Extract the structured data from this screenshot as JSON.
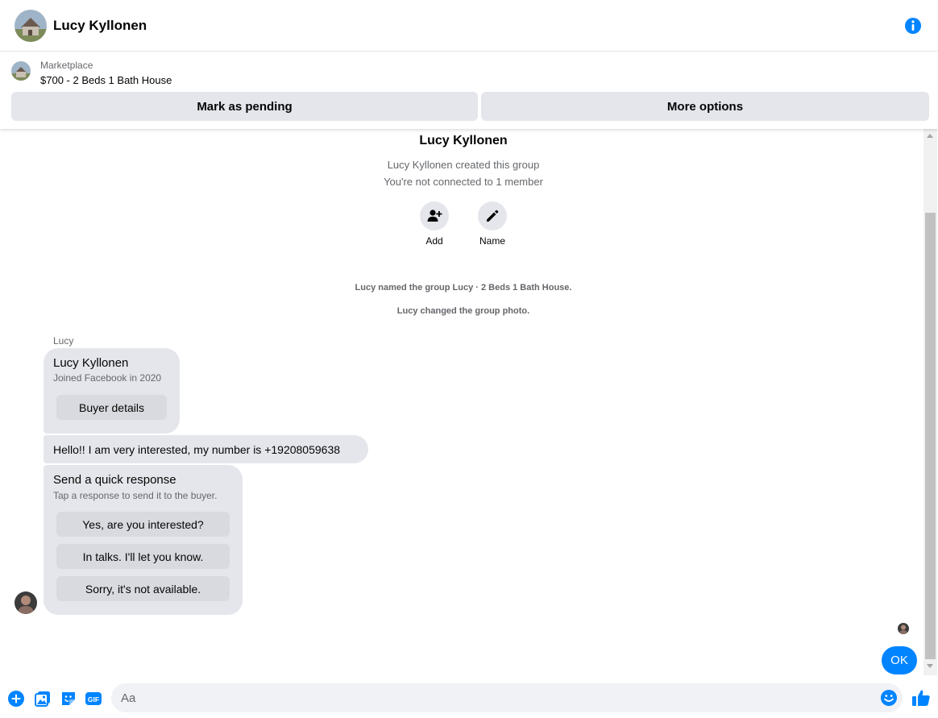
{
  "header": {
    "title": "Lucy Kyllonen",
    "accent": "#0084ff"
  },
  "listing": {
    "kind": "Marketplace",
    "item": "$700 - 2 Beds 1 Bath House",
    "mark_pending_label": "Mark as pending",
    "more_options_label": "More options"
  },
  "thread": {
    "group_name": "Lucy Kyllonen",
    "created_line": "Lucy Kyllonen created this group",
    "connection_line": "You're not connected to 1 member",
    "add_label": "Add",
    "name_label": "Name",
    "system_msgs": [
      "Lucy named the group Lucy · 2 Beds 1 Bath House.",
      "Lucy changed the group photo."
    ],
    "sender_name": "Lucy",
    "profile_card": {
      "name": "Lucy Kyllonen",
      "joined": "Joined Facebook in 2020",
      "button": "Buyer details"
    },
    "message": "Hello!! I am very interested, my number is +19208059638",
    "quick_response": {
      "title": "Send a quick response",
      "subtitle": "Tap a response to send it to the buyer.",
      "options": [
        "Yes, are you interested?",
        "In talks. I'll let you know.",
        "Sorry, it's not available."
      ]
    },
    "my_reply": "OK"
  },
  "composer": {
    "placeholder": "Aa"
  },
  "icons": [
    "info-icon",
    "add-person-icon",
    "pencil-icon",
    "plus-icon",
    "photo-icon",
    "sticker-icon",
    "gif-icon",
    "emoji-icon",
    "thumbs-up-icon"
  ]
}
